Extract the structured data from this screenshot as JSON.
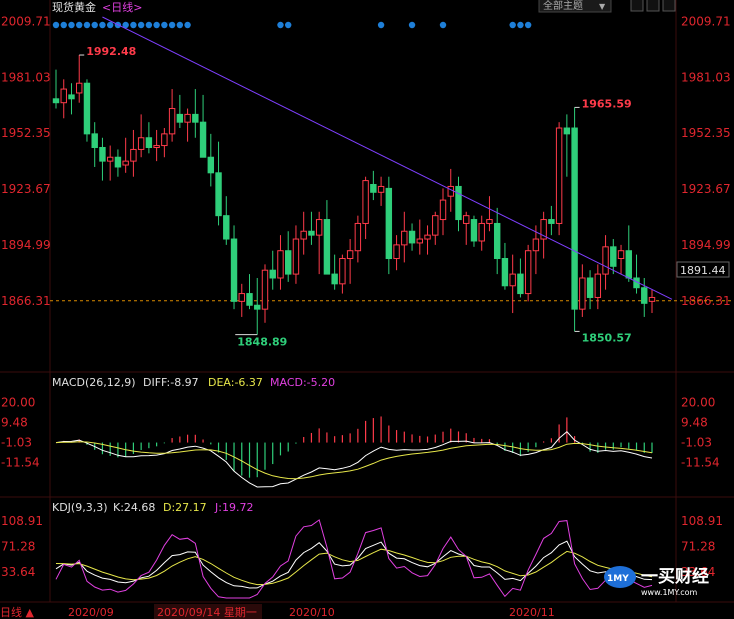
{
  "header": {
    "title": "现货黄金",
    "period": "<日线>",
    "dropdown_label": "全部主题"
  },
  "colors": {
    "up": "#ff3b4a",
    "down": "#2fcf7a",
    "bg": "#000000",
    "axis_text": "#e0262e",
    "grid": "#2a0a0a",
    "trend": "#7f3fff",
    "dash": "#d98a00",
    "dot": "#1e7fd8",
    "diff": "#ffffff",
    "dea": "#e6e64a",
    "macd": "#e040e0",
    "k": "#ffffff",
    "d": "#e6e64a",
    "j": "#e040e0"
  },
  "price_panel": {
    "y_ticks": [
      "2009.71",
      "1981.03",
      "1952.35",
      "1923.67",
      "1894.99",
      "1866.31"
    ],
    "current_price": "1891.44",
    "ylim": [
      1840,
      2012
    ],
    "annotations": {
      "high1": "1992.48",
      "high2": "1965.59",
      "low1": "1848.89",
      "low2": "1850.57"
    },
    "dash_level": 1866.31
  },
  "macd_panel": {
    "label": "MACD(26,12,9)",
    "diff_text": "DIFF:-8.97",
    "dea_text": "DEA:-6.37",
    "macd_text": "MACD:-5.20",
    "y_ticks": [
      "20.00",
      "9.48",
      "-1.03",
      "-11.54"
    ],
    "ylim": [
      -26,
      24
    ]
  },
  "kdj_panel": {
    "label": "KDJ(9,3,3)",
    "k_text": "K:24.68",
    "d_text": "D:27.17",
    "j_text": "J:19.72",
    "y_ticks": [
      "108.91",
      "71.28",
      "33.64"
    ],
    "ylim": [
      -5,
      115
    ]
  },
  "x_axis": {
    "corner_label": "日线 ▲",
    "labels": [
      "2020/09",
      "2020/10",
      "2020/11"
    ],
    "cursor_label": "2020/09/14 星期一"
  },
  "logo": {
    "brand": "一买财经",
    "url": "www.1MY.com",
    "badge": "1MY"
  },
  "chart_data": {
    "type": "candlestick",
    "candles": [
      [
        1970,
        1985,
        1965,
        1968
      ],
      [
        1968,
        1980,
        1960,
        1975
      ],
      [
        1972,
        1978,
        1962,
        1970
      ],
      [
        1973,
        1992.48,
        1968,
        1978
      ],
      [
        1978,
        1980,
        1948,
        1952
      ],
      [
        1952,
        1958,
        1935,
        1945
      ],
      [
        1945,
        1950,
        1928,
        1938
      ],
      [
        1938,
        1946,
        1928,
        1940
      ],
      [
        1940,
        1944,
        1930,
        1935
      ],
      [
        1936,
        1950,
        1932,
        1938
      ],
      [
        1938,
        1954,
        1930,
        1944
      ],
      [
        1944,
        1962,
        1940,
        1950
      ],
      [
        1950,
        1958,
        1942,
        1945
      ],
      [
        1945,
        1954,
        1938,
        1946
      ],
      [
        1946,
        1955,
        1940,
        1952
      ],
      [
        1952,
        1975,
        1948,
        1965
      ],
      [
        1962,
        1972,
        1955,
        1958
      ],
      [
        1958,
        1965,
        1948,
        1962
      ],
      [
        1962,
        1975,
        1950,
        1958
      ],
      [
        1958,
        1972,
        1940,
        1940
      ],
      [
        1940,
        1952,
        1925,
        1932
      ],
      [
        1932,
        1948,
        1905,
        1910
      ],
      [
        1910,
        1920,
        1895,
        1898
      ],
      [
        1898,
        1905,
        1862,
        1866
      ],
      [
        1866,
        1875,
        1858,
        1870
      ],
      [
        1870,
        1880,
        1862,
        1864
      ],
      [
        1864,
        1878,
        1848.89,
        1862
      ],
      [
        1862,
        1885,
        1855,
        1882
      ],
      [
        1882,
        1892,
        1872,
        1878
      ],
      [
        1878,
        1900,
        1872,
        1892
      ],
      [
        1892,
        1902,
        1876,
        1880
      ],
      [
        1880,
        1905,
        1875,
        1898
      ],
      [
        1898,
        1912,
        1890,
        1902
      ],
      [
        1902,
        1912,
        1895,
        1900
      ],
      [
        1900,
        1912,
        1880,
        1908
      ],
      [
        1908,
        1918,
        1880,
        1880
      ],
      [
        1880,
        1890,
        1872,
        1875
      ],
      [
        1875,
        1890,
        1870,
        1888
      ],
      [
        1888,
        1898,
        1875,
        1892
      ],
      [
        1892,
        1910,
        1886,
        1906
      ],
      [
        1906,
        1930,
        1898,
        1928
      ],
      [
        1926,
        1933,
        1918,
        1922
      ],
      [
        1922,
        1930,
        1915,
        1925
      ],
      [
        1924,
        1930,
        1880,
        1888
      ],
      [
        1888,
        1900,
        1882,
        1895
      ],
      [
        1895,
        1912,
        1886,
        1902
      ],
      [
        1902,
        1906,
        1892,
        1896
      ],
      [
        1896,
        1908,
        1890,
        1898
      ],
      [
        1898,
        1905,
        1890,
        1900
      ],
      [
        1900,
        1912,
        1895,
        1910
      ],
      [
        1908,
        1924,
        1900,
        1918
      ],
      [
        1920,
        1934,
        1912,
        1925
      ],
      [
        1925,
        1930,
        1902,
        1908
      ],
      [
        1906,
        1912,
        1895,
        1910
      ],
      [
        1908,
        1910,
        1894,
        1897
      ],
      [
        1897,
        1910,
        1892,
        1906
      ],
      [
        1906,
        1920,
        1902,
        1908
      ],
      [
        1906,
        1914,
        1880,
        1888
      ],
      [
        1888,
        1896,
        1872,
        1874
      ],
      [
        1874,
        1890,
        1860,
        1880
      ],
      [
        1880,
        1888,
        1868,
        1870
      ],
      [
        1870,
        1895,
        1866,
        1892
      ],
      [
        1892,
        1905,
        1880,
        1898
      ],
      [
        1898,
        1912,
        1888,
        1908
      ],
      [
        1908,
        1915,
        1900,
        1906
      ],
      [
        1906,
        1958,
        1900,
        1955
      ],
      [
        1955,
        1962,
        1930,
        1952
      ],
      [
        1955,
        1965.59,
        1850.57,
        1862
      ],
      [
        1862,
        1885,
        1858,
        1878
      ],
      [
        1878,
        1882,
        1862,
        1868
      ],
      [
        1868,
        1885,
        1862,
        1880
      ],
      [
        1880,
        1900,
        1872,
        1894
      ],
      [
        1894,
        1898,
        1880,
        1884
      ],
      [
        1888,
        1895,
        1880,
        1892
      ],
      [
        1892,
        1905,
        1876,
        1878
      ],
      [
        1878,
        1890,
        1870,
        1873
      ],
      [
        1873,
        1878,
        1858,
        1865
      ],
      [
        1866,
        1872,
        1860,
        1868
      ]
    ],
    "trendline": {
      "from_index": 6,
      "from_value": 2012,
      "to_index": 79,
      "to_value": 1866
    }
  }
}
